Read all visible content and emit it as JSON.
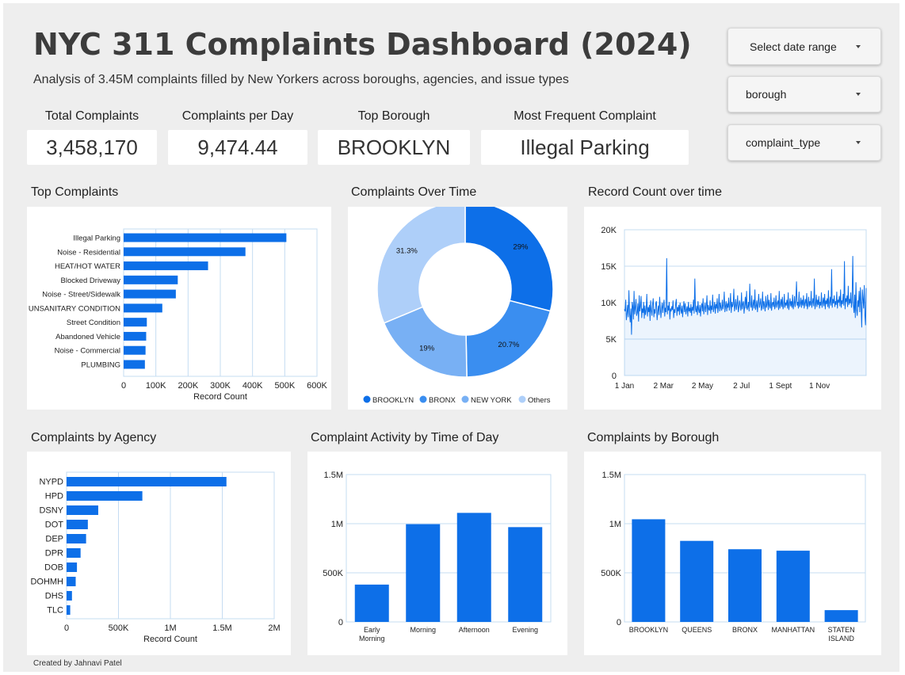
{
  "header": {
    "title": "NYC 311 Complaints Dashboard (2024)",
    "subtitle": "Analysis of 3.45M complaints filled by New Yorkers across boroughs, agencies, and issue types"
  },
  "kpis": [
    {
      "label": "Total Complaints",
      "value": "3,458,170"
    },
    {
      "label": "Complaints per Day",
      "value": "9,474.44"
    },
    {
      "label": "Top Borough",
      "value": "BROOKLYN"
    },
    {
      "label": "Most Frequent Complaint",
      "value": "Illegal Parking"
    }
  ],
  "controls": {
    "date_range": "Select date range",
    "borough": "borough",
    "complaint_type": "complaint_type"
  },
  "panels": {
    "top_complaints": "Top Complaints",
    "over_time_donut": "Complaints Over Time",
    "record_count": "Record Count over time",
    "by_agency": "Complaints by Agency",
    "time_of_day": "Complaint Activity by Time of Day",
    "by_borough": "Complaints by Borough"
  },
  "footer": "Created by Jahnavi Patel",
  "colors": {
    "primary": "#0d6fe8",
    "mid": "#3a8ef0",
    "light": "#78b0f4",
    "lighter": "#aecff9",
    "grid": "#c5dcf2"
  },
  "chart_data": [
    {
      "id": "top_complaints",
      "type": "bar",
      "orientation": "horizontal",
      "categories": [
        "Illegal Parking",
        "Noise - Residential",
        "HEAT/HOT WATER",
        "Blocked Driveway",
        "Noise - Street/Sidewalk",
        "UNSANITARY CONDITION",
        "Street Condition",
        "Abandoned Vehicle",
        "Noise - Commercial",
        "PLUMBING"
      ],
      "values": [
        505000,
        378000,
        262000,
        168000,
        162000,
        120000,
        72000,
        70000,
        68000,
        66000
      ],
      "xlabel": "Record Count",
      "xlim": [
        0,
        600000
      ],
      "xticks": [
        0,
        100000,
        200000,
        300000,
        400000,
        500000,
        600000
      ],
      "xtick_labels": [
        "0",
        "100K",
        "200K",
        "300K",
        "400K",
        "500K",
        "600K"
      ],
      "grid": true
    },
    {
      "id": "donut",
      "type": "pie",
      "donut": true,
      "slices": [
        {
          "label": "BROOKLYN",
          "value": 29,
          "text": "29%"
        },
        {
          "label": "BRONX",
          "value": 20.7,
          "text": "20.7%"
        },
        {
          "label": "NEW YORK",
          "value": 19,
          "text": "19%"
        },
        {
          "label": "Others",
          "value": 31.3,
          "text": "31.3%"
        }
      ],
      "legend": "bottom"
    },
    {
      "id": "record_count",
      "type": "line",
      "x_start": "2024-01-01",
      "ylim": [
        0,
        20000
      ],
      "yticks": [
        0,
        5000,
        10000,
        15000,
        20000
      ],
      "ytick_labels": [
        "0",
        "5K",
        "10K",
        "15K",
        "20K"
      ],
      "xtick_labels": [
        "1 Jan",
        "2 Mar",
        "2 May",
        "2 Jul",
        "1 Sept",
        "1 Nov"
      ],
      "xtick_days": [
        0,
        61,
        122,
        183,
        244,
        305
      ],
      "values": [
        9100,
        8800,
        10400,
        7600,
        8500,
        9700,
        8000,
        11700,
        8400,
        7300,
        9200,
        5600,
        10100,
        9500,
        7700,
        11600,
        8400,
        9300,
        10500,
        8200,
        8600,
        9900,
        7400,
        11000,
        8800,
        9500,
        10900,
        7900,
        9200,
        8600,
        10100,
        7800,
        9600,
        8300,
        9000,
        11200,
        8100,
        9400,
        8700,
        9700,
        7500,
        10300,
        8900,
        8200,
        9800,
        10600,
        8000,
        9100,
        8500,
        9900,
        10200,
        7600,
        8800,
        9600,
        8300,
        10800,
        9400,
        7900,
        9200,
        10000,
        8600,
        9700,
        10400,
        8100,
        9300,
        8700,
        16100,
        8400,
        9600,
        8900,
        10100,
        7700,
        9200,
        8800,
        9500,
        9000,
        10300,
        7900,
        9100,
        8600,
        9800,
        10500,
        8200,
        9400,
        8800,
        9700,
        8300,
        10000,
        9100,
        8500,
        9600,
        8000,
        9300,
        10200,
        8700,
        9900,
        8400,
        9000,
        9500,
        8100,
        10100,
        8800,
        9300,
        8600,
        9800,
        8200,
        9400,
        8900,
        10400,
        8500,
        13300,
        9100,
        8700,
        9600,
        8300,
        10200,
        9000,
        8600,
        9700,
        8100,
        9400,
        9900,
        8800,
        10600,
        8400,
        9200,
        10000,
        8700,
        9500,
        11000,
        8300,
        9700,
        9100,
        8900,
        10300,
        8500,
        9600,
        9000,
        11100,
        8700,
        9300,
        10100,
        8500,
        9800,
        9200,
        10600,
        8600,
        9400,
        11200,
        8800,
        10000,
        9300,
        8900,
        10400,
        9100,
        9700,
        11500,
        8700,
        9500,
        10200,
        8800,
        9900,
        9300,
        10700,
        8900,
        9600,
        11300,
        8600,
        10100,
        9400,
        9800,
        11900,
        8800,
        9500,
        10500,
        9000,
        9700,
        11000,
        8700,
        9300,
        10300,
        9600,
        8900,
        11400,
        9100,
        9800,
        10200,
        8500,
        9500,
        10800,
        9200,
        11600,
        9000,
        9400,
        10100,
        8800,
        12600,
        9700,
        9300,
        11000,
        8900,
        9600,
        10400,
        9200,
        11800,
        9000,
        9500,
        10300,
        8700,
        9900,
        11200,
        9300,
        9800,
        10600,
        8900,
        9400,
        11500,
        9100,
        10200,
        9600,
        8800,
        10900,
        9300,
        9700,
        11100,
        9000,
        10400,
        9500,
        9200,
        11300,
        8900,
        9800,
        10100,
        9400,
        10700,
        9100,
        9600,
        11000,
        9300,
        9900,
        10300,
        9000,
        11600,
        9200,
        9700,
        10500,
        9400,
        10800,
        9100,
        9500,
        11200,
        9300,
        10000,
        9600,
        10400,
        9200,
        11400,
        9000,
        9800,
        10600,
        9500,
        10200,
        9300,
        11100,
        9100,
        9700,
        10900,
        9400,
        10300,
        12900,
        9600,
        10100,
        9200,
        11500,
        9400,
        9800,
        10700,
        9300,
        10400,
        9600,
        11000,
        9200,
        9900,
        10500,
        9500,
        11300,
        9100,
        9700,
        10800,
        9400,
        10200,
        9600,
        11600,
        9300,
        10000,
        10600,
        9500,
        13300,
        9100,
        9800,
        11100,
        9400,
        10400,
        9700,
        10900,
        9200,
        10100,
        9600,
        11400,
        9300,
        9900,
        10700,
        9500,
        11200,
        9100,
        10300,
        9800,
        10600,
        9400,
        11700,
        9200,
        10000,
        10800,
        9600,
        14600,
        9300,
        10500,
        9900,
        11000,
        9400,
        10200,
        9700,
        11500,
        9200,
        10400,
        10000,
        10900,
        9500,
        11800,
        9300,
        10300,
        9800,
        11200,
        9600,
        15700,
        9100,
        10600,
        10100,
        11000,
        9400,
        12300,
        9700,
        10500,
        9900,
        11400,
        9300,
        10200,
        16400,
        9600,
        8600,
        11100,
        7900,
        12800,
        9000,
        8200,
        10300,
        9400,
        11600,
        8700,
        12100,
        9900,
        6600,
        11800,
        10500,
        9200,
        12400,
        8300,
        6900,
        12000
      ]
    },
    {
      "id": "by_agency",
      "type": "bar",
      "orientation": "horizontal",
      "categories": [
        "NYPD",
        "HPD",
        "DSNY",
        "DOT",
        "DEP",
        "DPR",
        "DOB",
        "DOHMH",
        "DHS",
        "TLC"
      ],
      "values": [
        1540000,
        730000,
        305000,
        205000,
        188000,
        135000,
        100000,
        88000,
        52000,
        35000
      ],
      "xlabel": "Record Count",
      "xlim": [
        0,
        2000000
      ],
      "xticks": [
        0,
        500000,
        1000000,
        1500000,
        2000000
      ],
      "xtick_labels": [
        "0",
        "500K",
        "1M",
        "1.5M",
        "2M"
      ],
      "grid": true
    },
    {
      "id": "time_of_day",
      "type": "bar",
      "orientation": "vertical",
      "categories": [
        [
          "Early",
          "Morning"
        ],
        [
          "Morning"
        ],
        [
          "Afternoon"
        ],
        [
          "Evening"
        ]
      ],
      "values": [
        380000,
        995000,
        1110000,
        965000
      ],
      "ylim": [
        0,
        1500000
      ],
      "yticks": [
        0,
        500000,
        1000000,
        1500000
      ],
      "ytick_labels": [
        "0",
        "500K",
        "1M",
        "1.5M"
      ],
      "grid": true
    },
    {
      "id": "by_borough",
      "type": "bar",
      "orientation": "vertical",
      "categories": [
        [
          "BROOKLYN"
        ],
        [
          "QUEENS"
        ],
        [
          "BRONX"
        ],
        [
          "MANHATTAN"
        ],
        [
          "STATEN",
          "ISLAND"
        ]
      ],
      "values": [
        1045000,
        825000,
        740000,
        725000,
        120000
      ],
      "ylim": [
        0,
        1500000
      ],
      "yticks": [
        0,
        500000,
        1000000,
        1500000
      ],
      "ytick_labels": [
        "0",
        "500K",
        "1M",
        "1.5M"
      ],
      "grid": true
    }
  ]
}
